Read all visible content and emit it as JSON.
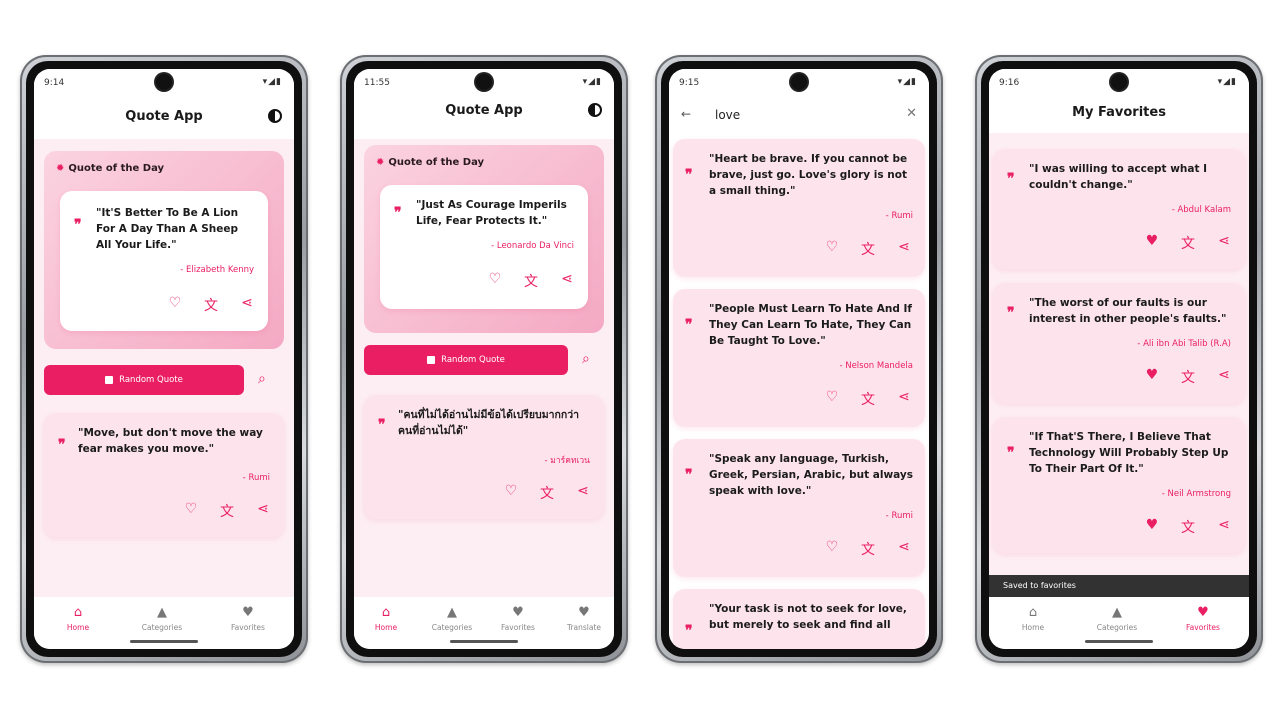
{
  "accent": "#e91e63",
  "icons": {
    "quote": "quote-mark-icon",
    "heart": "heart-icon",
    "translate": "translate-icon",
    "share": "share-icon",
    "search": "search-icon",
    "theme": "theme-toggle-icon",
    "home": "home-icon",
    "categories": "categories-icon",
    "favorites": "favorites-icon"
  },
  "screen1": {
    "time": "9:14",
    "app_title": "Quote App",
    "qod_header": "Quote of the Day",
    "qod_text": "\"It'S Better To Be A Lion For A Day Than A Sheep All Your Life.\"",
    "qod_author": "- Elizabeth Kenny",
    "random_label": "Random Quote",
    "quote_text": "\"Move, but don't move the way fear makes you move.\"",
    "quote_author": "- Rumi",
    "nav": [
      "Home",
      "Categories",
      "Favorites"
    ]
  },
  "screen2": {
    "time": "11:55",
    "app_title": "Quote App",
    "qod_header": "Quote of the Day",
    "qod_text": "\"Just As Courage Imperils Life, Fear Protects It.\"",
    "qod_author": "- Leonardo Da Vinci",
    "random_label": "Random Quote",
    "quote_text": "\"คนที่ไม่ได้อ่านไม่มีข้อได้เปรียบมากกว่าคนที่อ่านไม่ได้\"",
    "quote_author": "- มาร์คทเวน",
    "nav": [
      "Home",
      "Categories",
      "Favorites",
      "Translate"
    ]
  },
  "screen3": {
    "time": "9:15",
    "search_query": "love",
    "results": [
      {
        "text": "\"Heart be brave. If you cannot be brave, just go. Love's glory is not a small thing.\"",
        "author": "- Rumi"
      },
      {
        "text": "\"People Must Learn To Hate And If They Can Learn To Hate, They Can Be Taught To Love.\"",
        "author": "- Nelson Mandela"
      },
      {
        "text": "\"Speak any language, Turkish, Greek, Persian, Arabic, but always speak with love.\"",
        "author": "- Rumi"
      },
      {
        "text": "\"Your task is not to seek for love, but merely to seek and find all",
        "author": ""
      }
    ]
  },
  "screen4": {
    "time": "9:16",
    "title": "My Favorites",
    "favorites": [
      {
        "text": "\"I was willing to accept what I couldn't change.\"",
        "author": "- Abdul Kalam"
      },
      {
        "text": "\"The worst of our faults is our interest in other people's faults.\"",
        "author": "- Ali ibn Abi Talib (R.A)"
      },
      {
        "text": "\"If That'S There, I Believe That Technology Will Probably Step Up To Their Part Of It.\"",
        "author": "- Neil Armstrong"
      }
    ],
    "snackbar": "Saved to favorites",
    "nav": [
      "Home",
      "Categories",
      "Favorites"
    ]
  }
}
